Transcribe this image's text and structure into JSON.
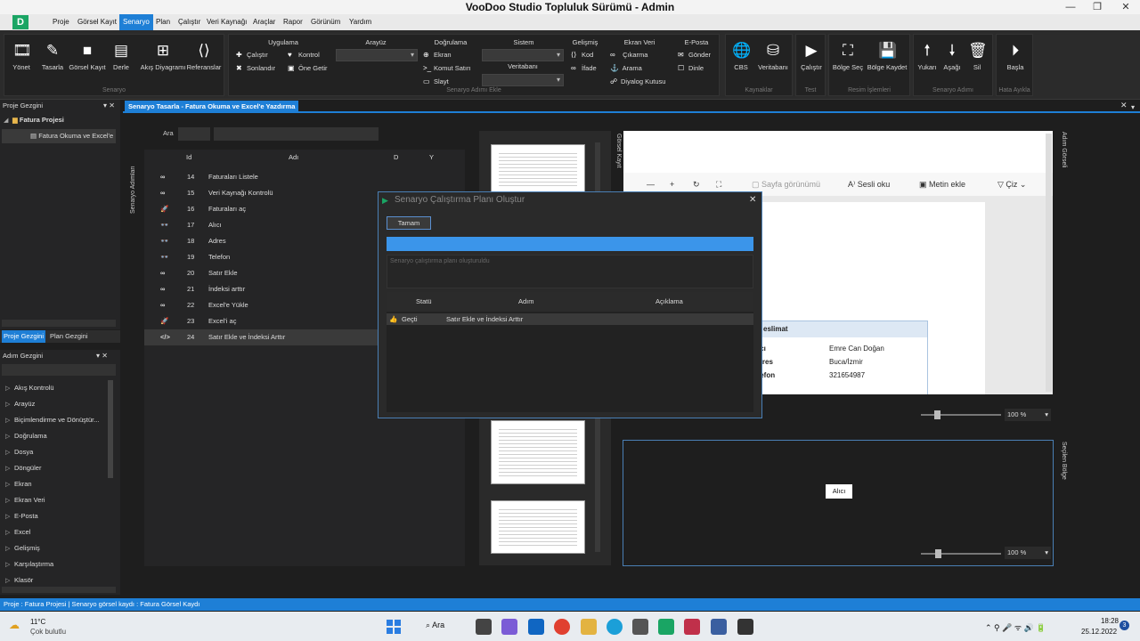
{
  "title": "VooDoo Studio Topluluk Sürümü - Admin",
  "menu": [
    "Proje",
    "Görsel Kayıt",
    "Senaryo",
    "Plan",
    "Çalıştır",
    "Veri Kaynağı",
    "Araçlar",
    "Rapor",
    "Görünüm",
    "Yardım"
  ],
  "ribbon": {
    "g1_buttons": [
      "Yönet",
      "Tasarla",
      "Görsel Kayıt",
      "Derle",
      "Akış Diyagramı",
      "Referanslar"
    ],
    "g1_label": "Senaryo",
    "uygulama": "Uygulama",
    "calistir": "Çalıştır",
    "sonlandir": "Sonlandır",
    "kontrol": "Kontrol",
    "one_getir": "Öne Getir",
    "arayuz": "Arayüz",
    "dogrulama": "Doğrulama",
    "ekran": "Ekran",
    "komut_satiri": "Komut Satırı",
    "slayt": "Slayt",
    "sistem": "Sistem",
    "veritabani": "Veritabanı",
    "gelismis": "Gelişmiş",
    "kod": "Kod",
    "ifade": "İfade",
    "ekran_veri": "Ekran Veri",
    "cikarma": "Çıkarma",
    "arama": "Arama",
    "diyalog": "Diyalog Kutusu",
    "eposta": "E-Posta",
    "gonder": "Gönder",
    "dinle": "Dinle",
    "adim_ekle": "Senaryo Adımı Ekle",
    "cbs": "CBS",
    "veritabani_btn": "Veritabanı",
    "kaynaklar": "Kaynaklar",
    "calistir_btn": "Çalıştır",
    "test": "Test",
    "bolge_sec": "Bölge Seç",
    "bolge_kaydet": "Bölge Kaydet",
    "resim": "Resim İşlemleri",
    "yukari": "Yukarı",
    "asagi": "Aşağı",
    "sil": "Sil",
    "senaryo_adimi": "Senaryo Adımı",
    "basla": "Başla",
    "hata": "Hata Ayıkla"
  },
  "proje_gezgini": {
    "title": "Proje Gezgini",
    "project": "Fatura Projesi",
    "child": "Fatura Okuma ve Excel'e",
    "tab1": "Proje Gezgini",
    "tab2": "Plan Gezgini"
  },
  "adim_gezgini": {
    "title": "Adım Gezgini",
    "items": [
      "Akış Kontrolü",
      "Arayüz",
      "Biçimlendirme ve Dönüştür...",
      "Doğrulama",
      "Dosya",
      "Döngüler",
      "Ekran",
      "Ekran Veri",
      "E-Posta",
      "Excel",
      "Gelişmiş",
      "Karşılaştırma",
      "Klasör"
    ]
  },
  "doc_tab": "Senaryo Tasarla - Fatura Okuma ve Excel'e Yazdırma",
  "side_label_adimlar": "Senaryo Adımları",
  "search_label": "Ara",
  "steps": {
    "headers": [
      "Id",
      "Adı",
      "D",
      "Y"
    ],
    "rows": [
      {
        "icon": "∞",
        "id": "14",
        "name": "Faturaları Listele"
      },
      {
        "icon": "∞",
        "id": "15",
        "name": "Veri Kaynağı Kontrolü"
      },
      {
        "icon": "🚀",
        "id": "16",
        "name": "Faturaları aç"
      },
      {
        "icon": "👓",
        "id": "17",
        "name": "Alıcı"
      },
      {
        "icon": "👓",
        "id": "18",
        "name": "Adres"
      },
      {
        "icon": "👓",
        "id": "19",
        "name": "Telefon"
      },
      {
        "icon": "∞",
        "id": "20",
        "name": "Satır Ekle"
      },
      {
        "icon": "∞",
        "id": "21",
        "name": "İndeksi arttır"
      },
      {
        "icon": "∞",
        "id": "22",
        "name": "Excel'e Yükle"
      },
      {
        "icon": "🚀",
        "id": "23",
        "name": "Excel'i aç"
      },
      {
        "icon": "</>",
        "id": "24",
        "name": "Satır Ekle ve İndeksi Arttır"
      }
    ]
  },
  "gorsel_kayit": "Görsel Kayıt",
  "adim_gorseli": "Adım Görseli",
  "secilen_bolge": "Seçilen Bölge",
  "preview": {
    "toolbar": [
      "Sayfa görünümü",
      "Sesli oku",
      "Metin ekle",
      "Çiz"
    ],
    "teslimat": "eslimat",
    "labels": [
      "ıcı",
      "dres",
      "lefon"
    ],
    "values": [
      "Emre Can Doğan",
      "Buca/İzmir",
      "321654987"
    ],
    "zoom": "100 %",
    "zoom2": "100 %",
    "alici": "Alıcı"
  },
  "dialog": {
    "title": "Senaryo Çalıştırma Planı Oluştur",
    "ok": "Tamam",
    "progress": 1.0,
    "message": "Senaryo çalıştırma planı oluşturuldu",
    "headers": [
      "Statü",
      "Adım",
      "Açıklama"
    ],
    "row": {
      "status": "Geçti",
      "step": "Satır Ekle ve İndeksi Arttır",
      "desc": ""
    }
  },
  "status": "Proje : Fatura Projesi  |  Senaryo görsel kaydı : Fatura Görsel Kaydı",
  "taskbar": {
    "weather_temp": "11°C",
    "weather_desc": "Çok bulutlu",
    "search": "Ara",
    "time": "18:28",
    "date": "25.12.2022",
    "notif": "3"
  }
}
